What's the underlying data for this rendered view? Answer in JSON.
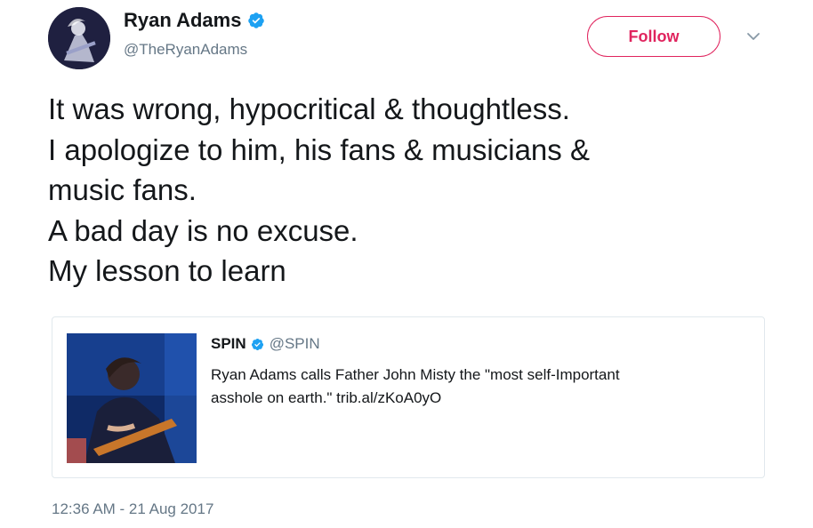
{
  "author": {
    "name": "Ryan Adams",
    "handle": "@TheRyanAdams",
    "verified": true,
    "avatar_icon": "avatar-photo"
  },
  "follow_button": {
    "label": "Follow",
    "color": "#e0245e"
  },
  "menu_icon": "chevron-down-icon",
  "tweet": {
    "lines": [
      "It was wrong, hypocritical & thoughtless.",
      "I apologize to him, his fans & musicians &",
      "music fans.",
      "A bad day is no excuse.",
      "My lesson to learn"
    ]
  },
  "quoted": {
    "name": "SPIN",
    "handle": "@SPIN",
    "verified": true,
    "text_lines": [
      "Ryan Adams calls Father John Misty the \"most self-Important",
      "asshole on earth.\" trib.al/zKoA0yO"
    ],
    "image_icon": "musician-photo"
  },
  "timestamp": "12:36 AM - 21 Aug 2017",
  "colors": {
    "verified": "#1da1f2",
    "secondary_text": "#657786",
    "border": "#e1e8ed"
  }
}
